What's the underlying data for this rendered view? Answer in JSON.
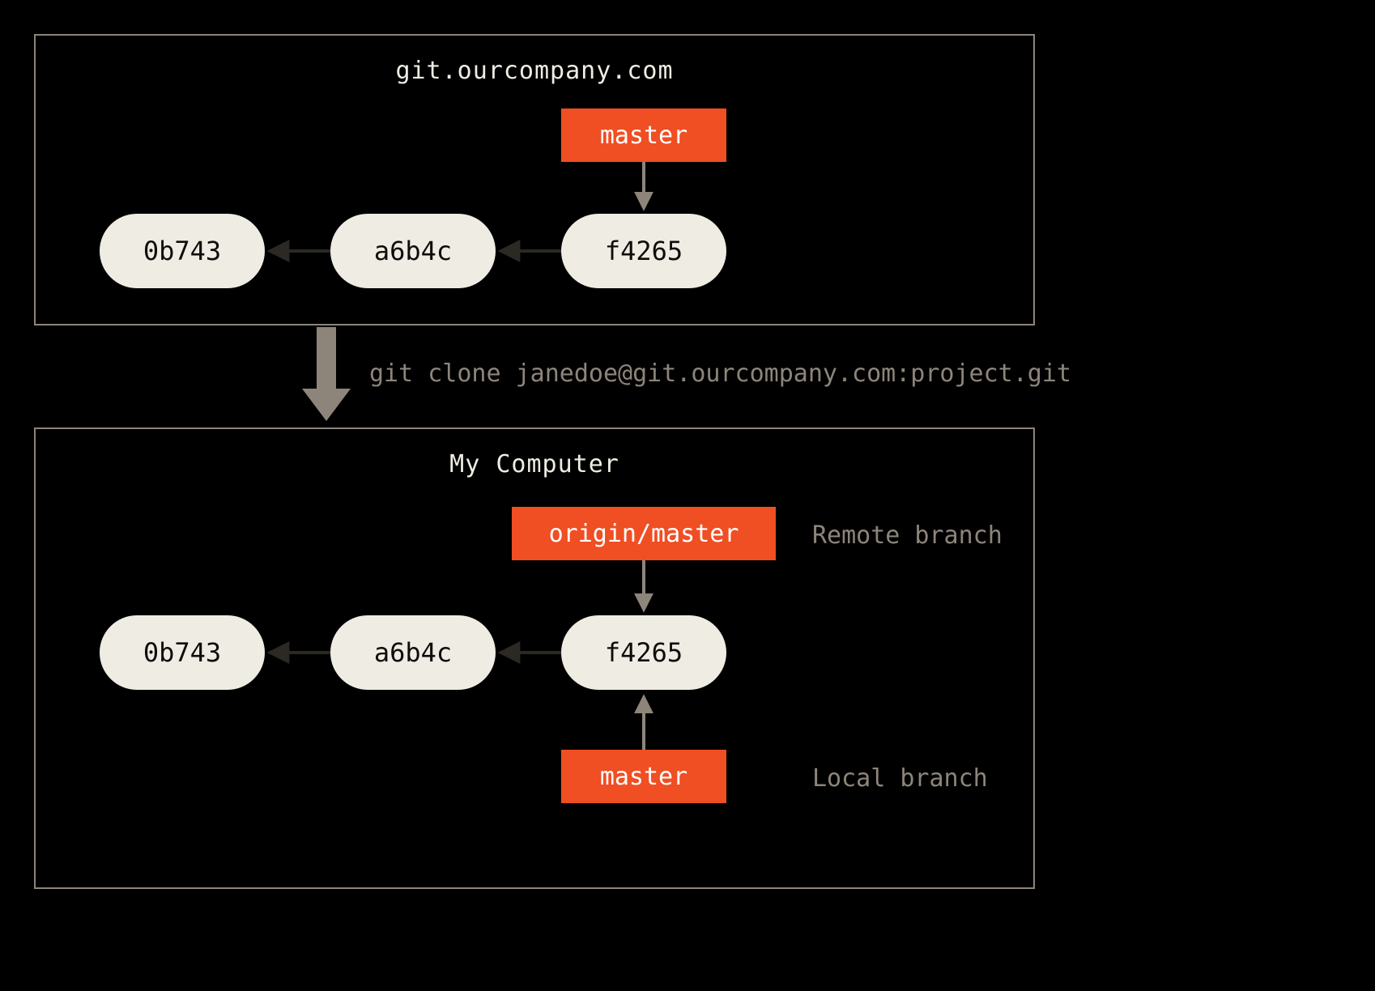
{
  "colors": {
    "bg": "#000000",
    "panel_border": "#8d857a",
    "commit_fill": "#efece3",
    "commit_text": "#0e0d0c",
    "branch_fill": "#f04e23",
    "branch_text": "#ffffff",
    "muted_text": "#8d857a",
    "arrow_gray": "#8d857a",
    "arrow_dark": "#2c2824"
  },
  "server": {
    "title": "git.ourcompany.com",
    "commits": [
      "0b743",
      "a6b4c",
      "f4265"
    ],
    "branch": {
      "name": "master"
    }
  },
  "clone_command": "git clone janedoe@git.ourcompany.com:project.git",
  "local": {
    "title": "My Computer",
    "commits": [
      "0b743",
      "a6b4c",
      "f4265"
    ],
    "remote_branch": {
      "name": "origin/master",
      "label": "Remote branch"
    },
    "local_branch": {
      "name": "master",
      "label": "Local branch"
    }
  }
}
